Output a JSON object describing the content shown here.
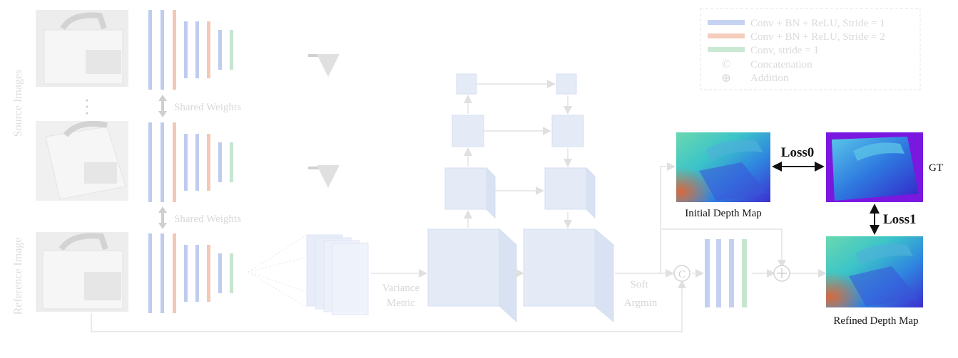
{
  "labels": {
    "source_images": "Source Images",
    "reference_image": "Reference Image",
    "shared_weights_1": "Shared Weights",
    "shared_weights_2": "Shared Weights",
    "variance_line1": "Variance",
    "variance_line2": "Metric",
    "soft_line1": "Soft",
    "soft_line2": "Argmin",
    "initial_depth_map": "Initial Depth Map",
    "refined_depth_map": "Refined Depth Map",
    "gt": "GT",
    "loss0": "Loss0",
    "loss1": "Loss1",
    "dots": "⋮"
  },
  "legend": {
    "items": [
      {
        "text": "Conv + BN + ReLU, Stride = 1",
        "color": "#9db3e8",
        "kind": "bar"
      },
      {
        "text": "Conv + BN + ReLU, Stride = 2",
        "color": "#f2b9a0",
        "kind": "bar"
      },
      {
        "text": "Conv, stride = 1",
        "color": "#b3dcbf",
        "kind": "bar"
      },
      {
        "text": "Concatenation",
        "symbol": "©",
        "kind": "symbol"
      },
      {
        "text": "Addition",
        "symbol": "⊕",
        "kind": "symbol"
      }
    ]
  },
  "symbols": {
    "concat": "C",
    "add": "+"
  },
  "colors": {
    "faded_text": "#dcdcdc",
    "faded_line": "#e3e3e3",
    "stride1": "#b9c8ef",
    "stride2": "#f2c3b0",
    "conv": "#c2e3cc",
    "cube": "#e2eaf6",
    "gt_background": "#7a18e0"
  }
}
